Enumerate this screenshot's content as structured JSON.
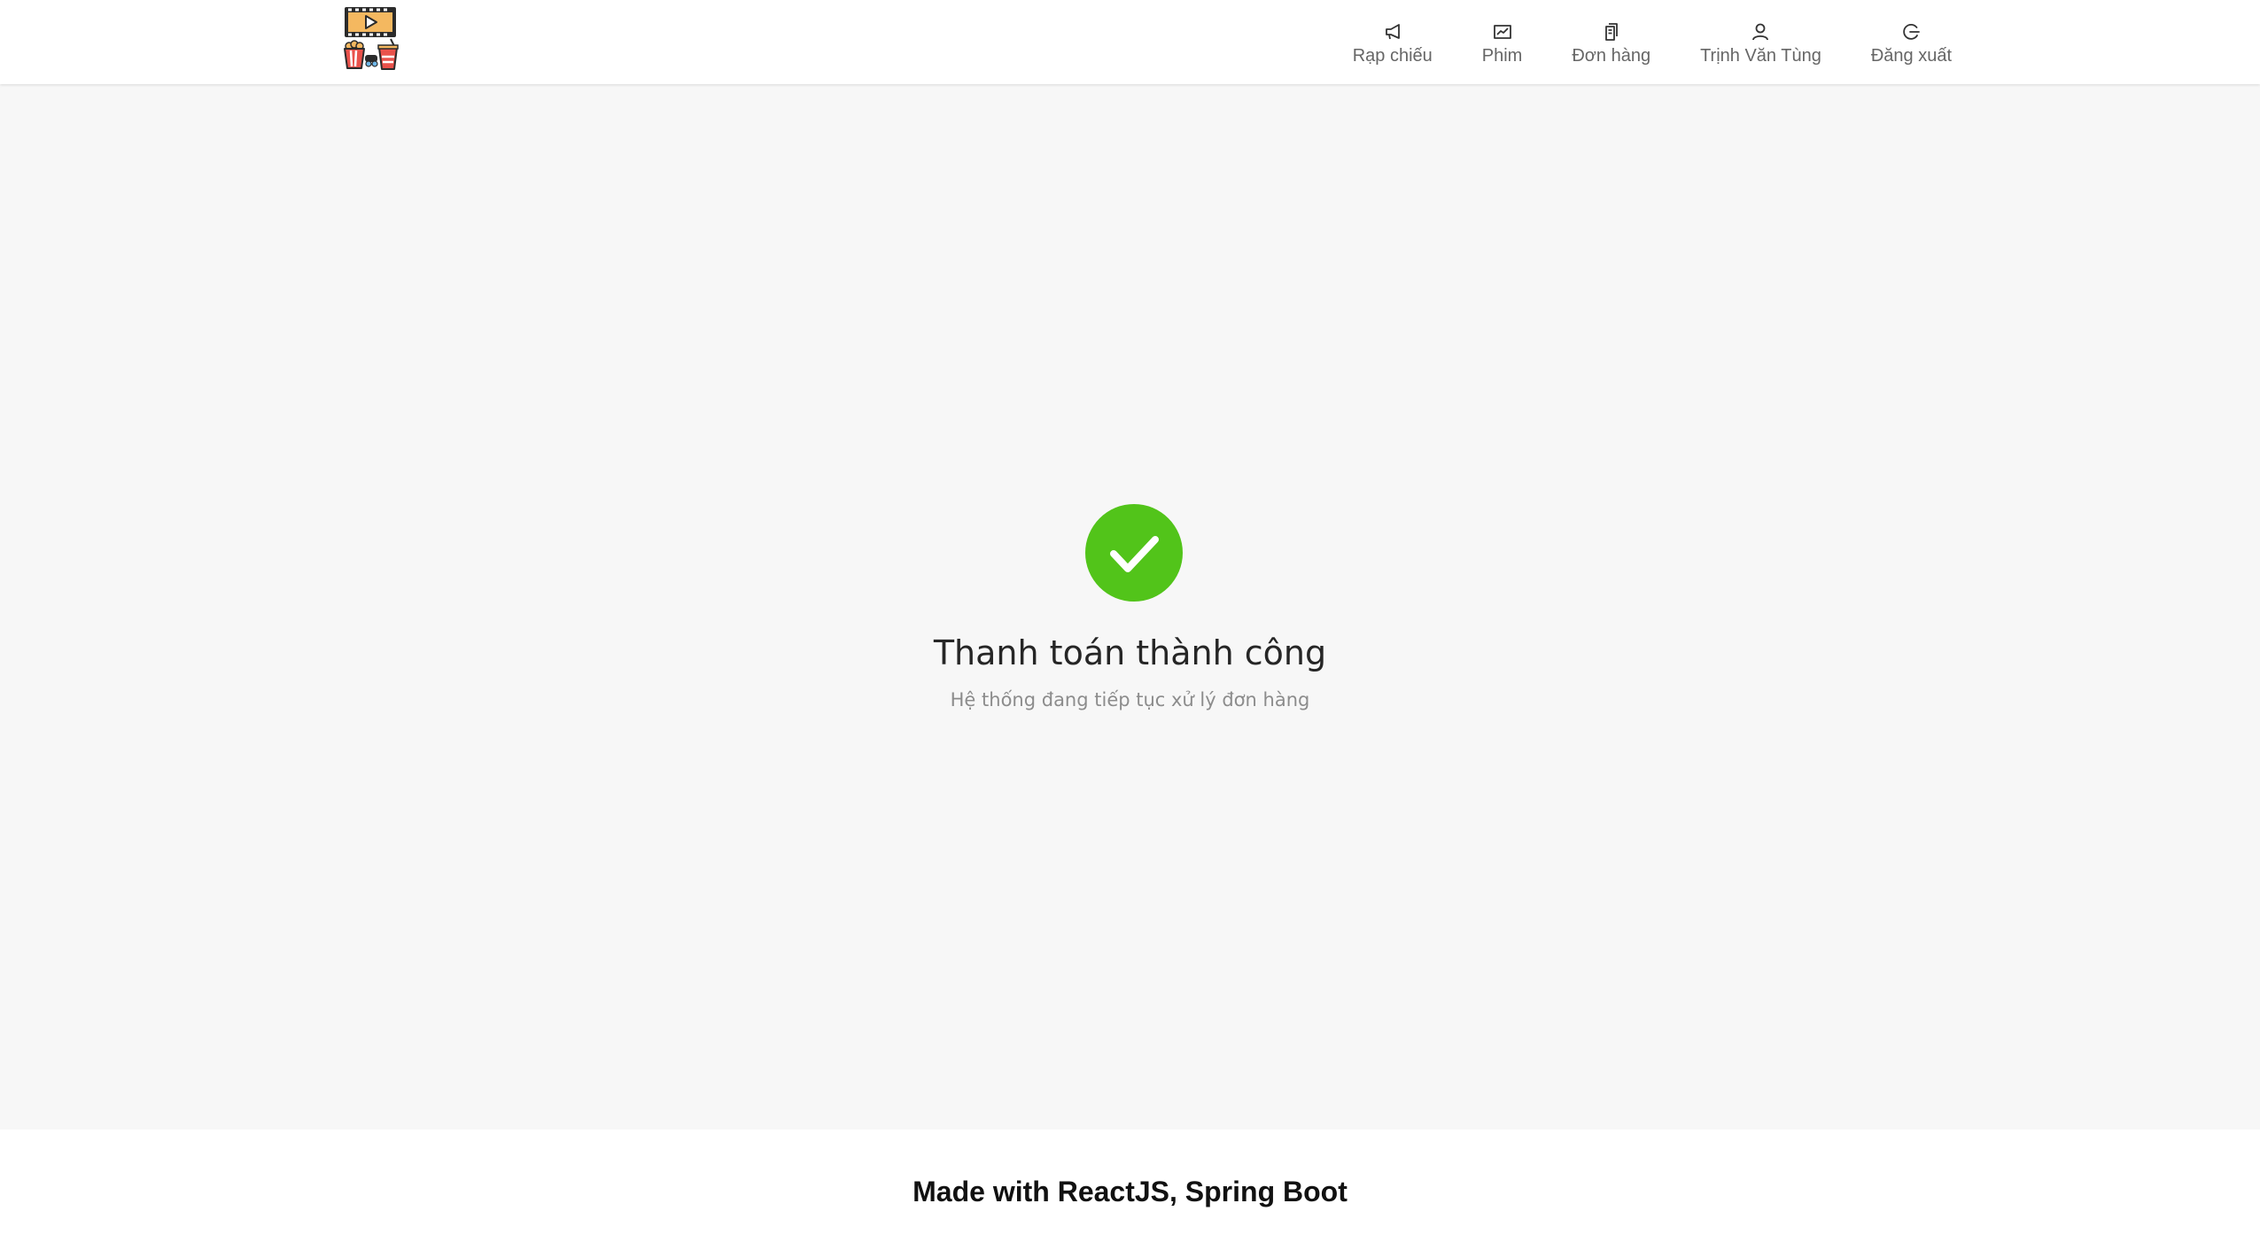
{
  "colors": {
    "success": "#52c41a",
    "header_bg": "#ffffff",
    "page_bg": "#f7f7f7",
    "nav_text": "#666666"
  },
  "header": {
    "logo_icon": "cinema-popcorn-logo",
    "nav": [
      {
        "label": "Rạp chiếu",
        "icon": "megaphone-icon"
      },
      {
        "label": "Phim",
        "icon": "chart-icon"
      },
      {
        "label": "Đơn hàng",
        "icon": "document-icon"
      },
      {
        "label": "Trịnh Văn Tùng",
        "icon": "user-icon"
      },
      {
        "label": "Đăng xuất",
        "icon": "logout-icon"
      }
    ]
  },
  "result": {
    "icon": "check-circle-icon",
    "title": "Thanh toán thành công",
    "subtitle": "Hệ thống đang tiếp tục xử lý đơn hàng"
  },
  "footer": {
    "text": "Made with ReactJS, Spring Boot"
  }
}
